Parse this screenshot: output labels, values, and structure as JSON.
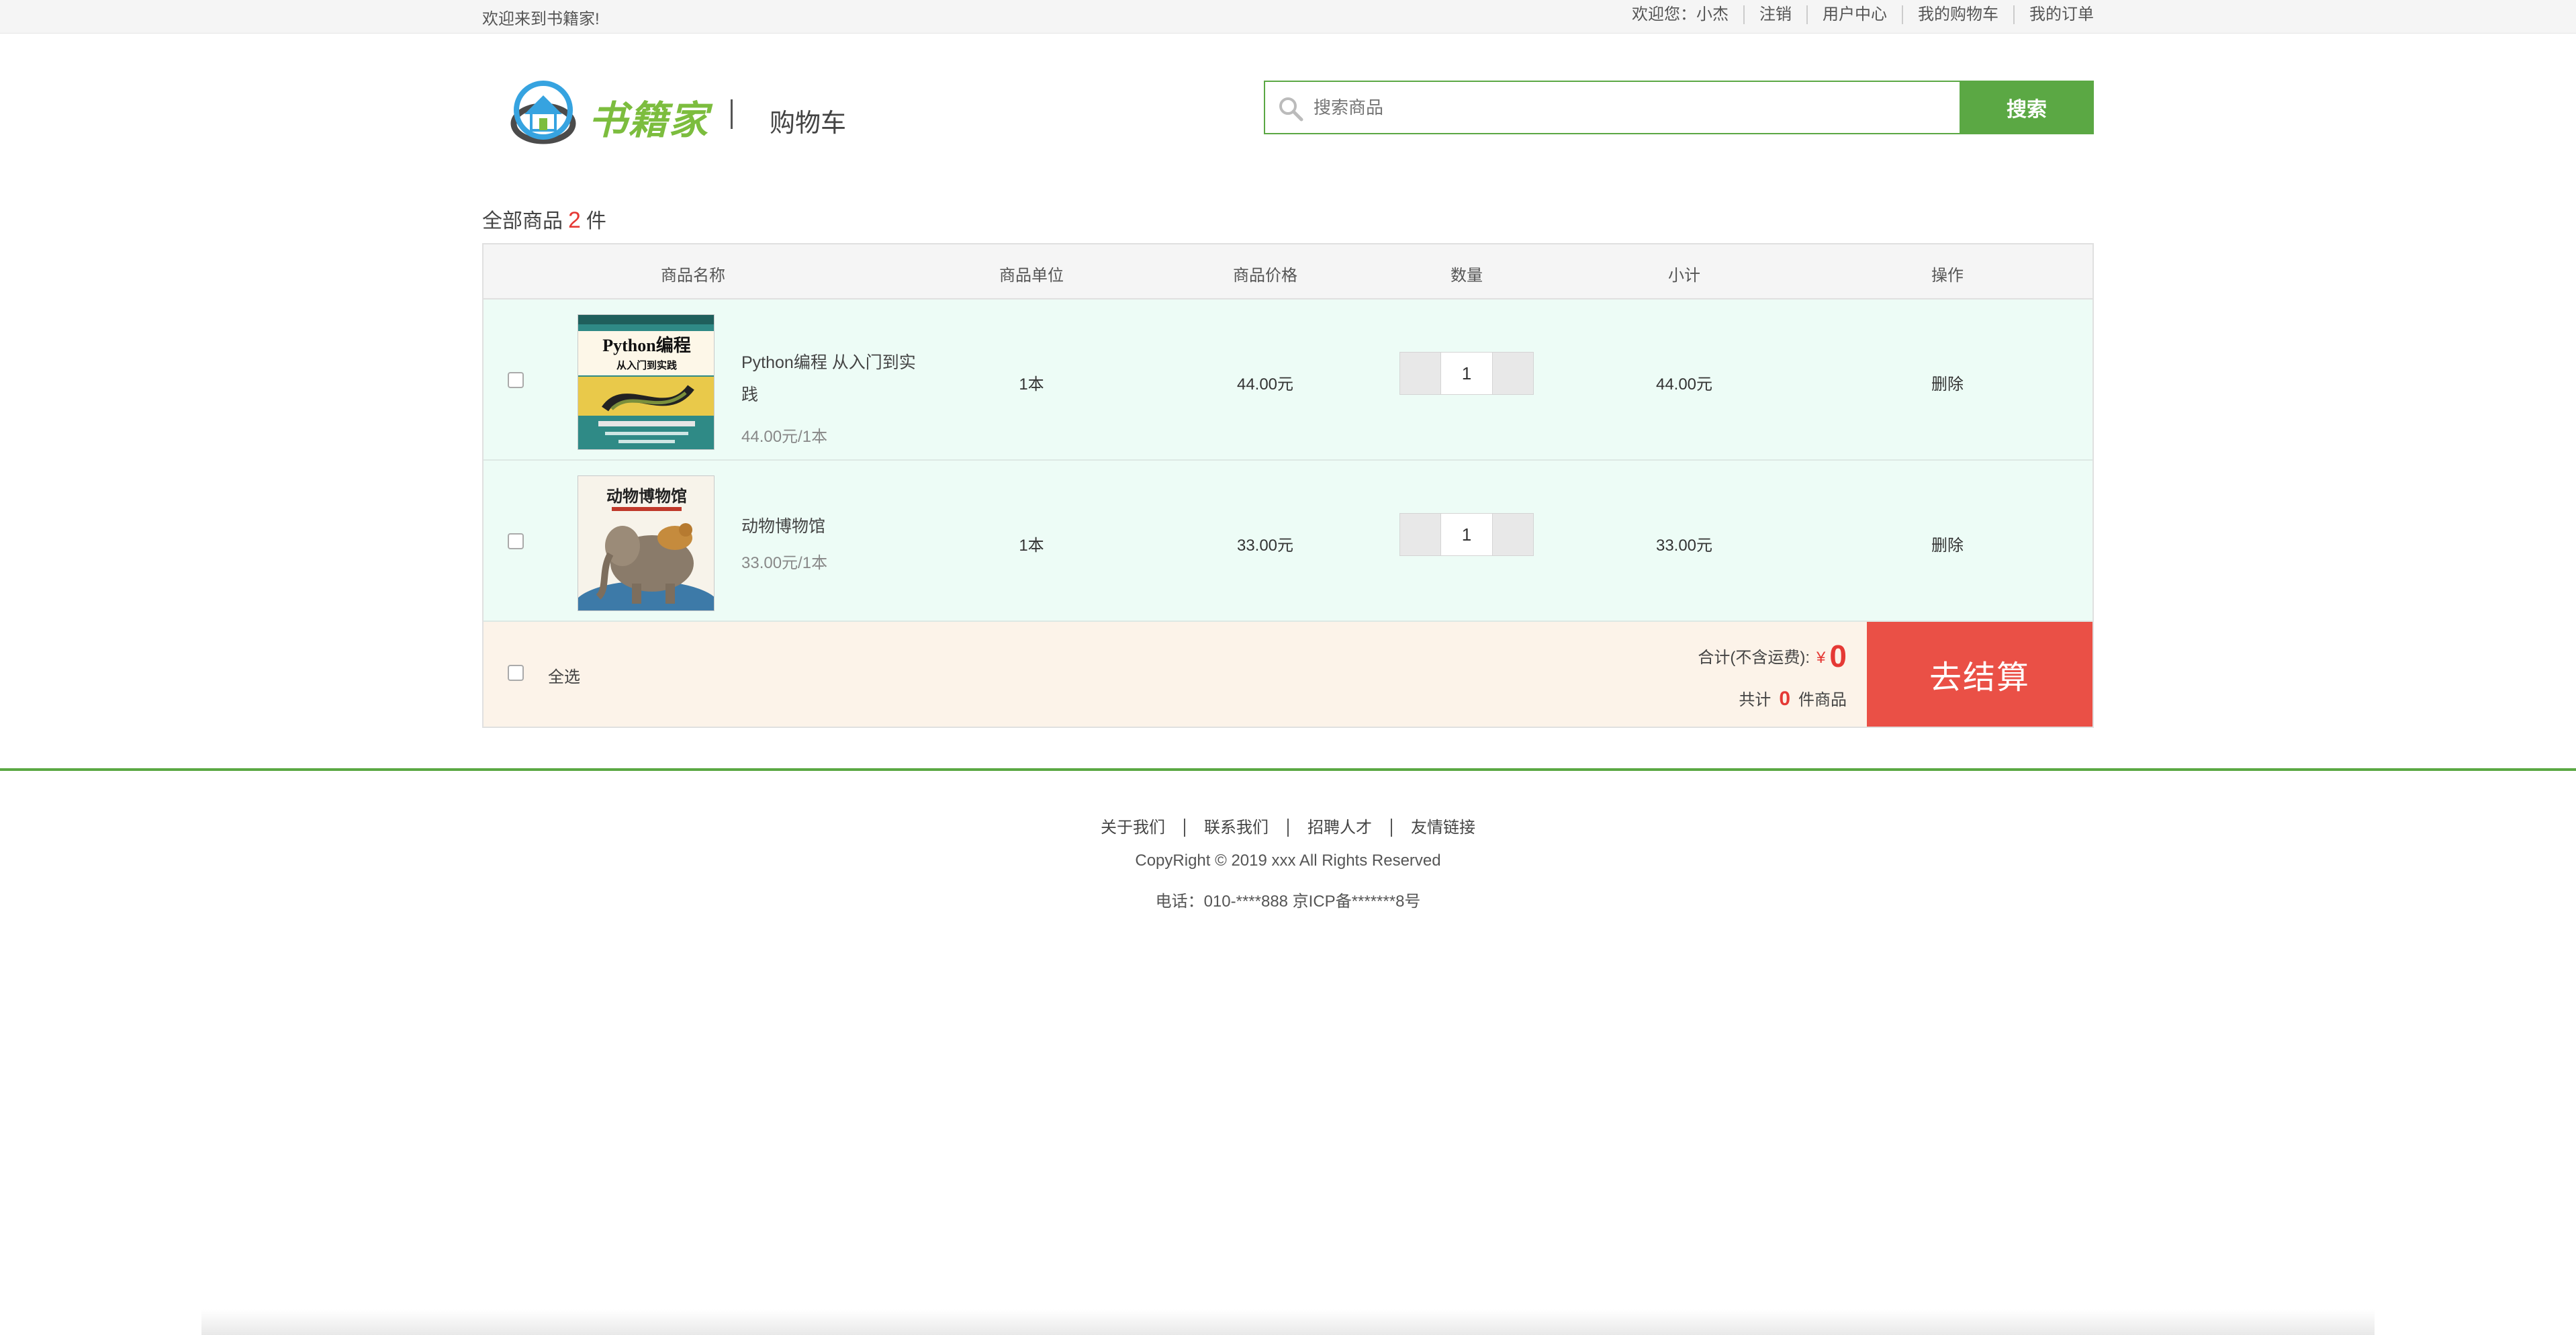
{
  "topbar": {
    "welcome": "欢迎来到书籍家!",
    "user": "欢迎您：小杰",
    "logout": "注销",
    "user_center": "用户中心",
    "my_cart": "我的购物车",
    "my_orders": "我的订单"
  },
  "header": {
    "logo_text": "书籍家",
    "page_name": "购物车",
    "search_placeholder": "搜索商品",
    "search_button": "搜索"
  },
  "summary": {
    "prefix": "全部商品",
    "count": "2",
    "suffix": "件"
  },
  "table": {
    "columns": [
      "商品名称",
      "商品单位",
      "商品价格",
      "数量",
      "小计",
      "操作"
    ],
    "rows": [
      {
        "name": "Python编程 从入门到实践",
        "unit_price_text": "44.00元/1本",
        "unit": "1本",
        "price": "44.00元",
        "quantity": "1",
        "subtotal": "44.00元",
        "action": "删除",
        "cover_title": "Python编程",
        "cover_subtitle": "从入门到实践"
      },
      {
        "name": "动物博物馆",
        "unit_price_text": "33.00元/1本",
        "unit": "1本",
        "price": "33.00元",
        "quantity": "1",
        "subtotal": "33.00元",
        "action": "删除",
        "cover_title": "动物博物馆"
      }
    ]
  },
  "footer_bar": {
    "select_all": "全选",
    "total_label": "合计(不含运费):",
    "currency": "¥",
    "total_amount": "0",
    "items_prefix": "共计",
    "items_count": "0",
    "items_suffix": "件商品",
    "checkout": "去结算"
  },
  "footer": {
    "links": [
      "关于我们",
      "联系我们",
      "招聘人才",
      "友情链接"
    ],
    "copyright": "CopyRight © 2019 xxx All Rights Reserved",
    "phone": "电话：010-****888 京ICP备*******8号"
  },
  "colors": {
    "brand_green": "#5ba844",
    "accent_red": "#ea5046",
    "row_bg": "#edfcf6",
    "footer_bar_bg": "#fcf3e9"
  }
}
